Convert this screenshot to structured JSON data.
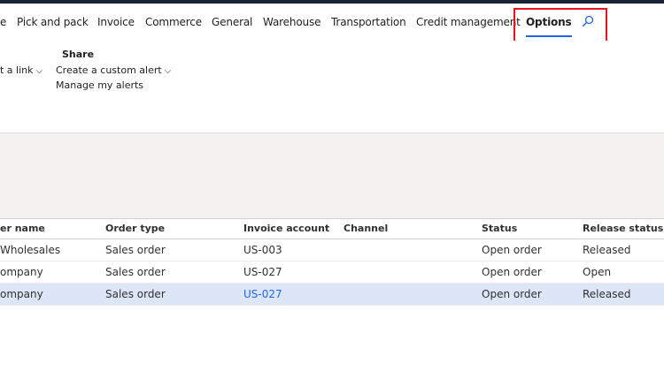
{
  "ribbon_tabs": [
    {
      "label": "e"
    },
    {
      "label": "Pick and pack"
    },
    {
      "label": "Invoice"
    },
    {
      "label": "Commerce"
    },
    {
      "label": "General"
    },
    {
      "label": "Warehouse"
    },
    {
      "label": "Transportation"
    },
    {
      "label": "Credit management"
    },
    {
      "label": "Options"
    }
  ],
  "active_tab": "Options",
  "search_icon": "search-icon",
  "ribbon": {
    "share_group_title": "Share",
    "get_link_label": "t a link",
    "create_alert_label": "Create a custom alert",
    "manage_alerts_label": "Manage my alerts"
  },
  "grid": {
    "columns": [
      "er name",
      "Order type",
      "Invoice account",
      "Channel",
      "Status",
      "Release status"
    ],
    "rows": [
      {
        "name": "Wholesales",
        "order_type": "Sales order",
        "invoice_account": "US-003",
        "channel": "",
        "status": "Open order",
        "release_status": "Released"
      },
      {
        "name": "ompany",
        "order_type": "Sales order",
        "invoice_account": "US-027",
        "channel": "",
        "status": "Open order",
        "release_status": "Open"
      },
      {
        "name": "ompany",
        "order_type": "Sales order",
        "invoice_account": "US-027",
        "channel": "",
        "status": "Open order",
        "release_status": "Released"
      }
    ]
  },
  "colors": {
    "accent": "#2266e3",
    "highlight_border": "#e8141c",
    "selected_row": "#dce6f7",
    "gray_area": "#f3f2f1"
  }
}
